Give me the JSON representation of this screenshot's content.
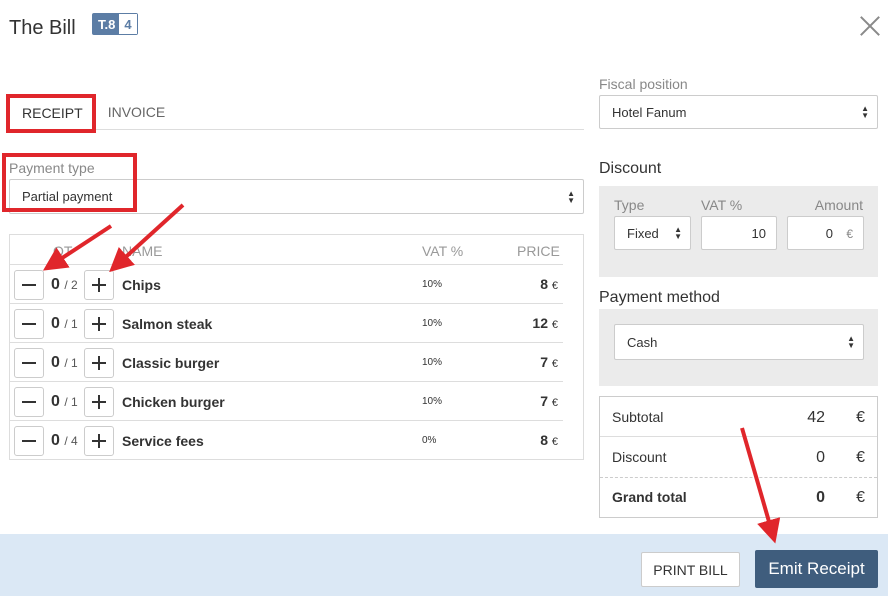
{
  "header": {
    "title": "The Bill",
    "table_code": "T.8",
    "guest_count": "4",
    "close_icon": "close-icon"
  },
  "tabs": [
    {
      "label": "RECEIPT",
      "active": true
    },
    {
      "label": "INVOICE",
      "active": false
    }
  ],
  "payment_type": {
    "label": "Payment type",
    "value": "Partial payment"
  },
  "table": {
    "headers": {
      "qty": "QT",
      "name": "NAME",
      "vat": "VAT %",
      "price": "PRICE"
    },
    "rows": [
      {
        "qty": "0",
        "max": "/ 2",
        "name": "Chips",
        "vat": "10%",
        "price": "8",
        "currency": "€"
      },
      {
        "qty": "0",
        "max": "/ 1",
        "name": "Salmon steak",
        "vat": "10%",
        "price": "12",
        "currency": "€"
      },
      {
        "qty": "0",
        "max": "/ 1",
        "name": "Classic burger",
        "vat": "10%",
        "price": "7",
        "currency": "€"
      },
      {
        "qty": "0",
        "max": "/ 1",
        "name": "Chicken burger",
        "vat": "10%",
        "price": "7",
        "currency": "€"
      },
      {
        "qty": "0",
        "max": "/ 4",
        "name": "Service fees",
        "vat": "0%",
        "price": "8",
        "currency": "€"
      }
    ]
  },
  "fiscal_position": {
    "label": "Fiscal position",
    "value": "Hotel Fanum"
  },
  "discount": {
    "title": "Discount",
    "type_label": "Type",
    "type_value": "Fixed",
    "vat_label": "VAT %",
    "vat_value": "10",
    "amount_label": "Amount",
    "amount_value": "0",
    "amount_currency": "€"
  },
  "payment_method": {
    "title": "Payment method",
    "value": "Cash"
  },
  "totals": {
    "subtotal_label": "Subtotal",
    "subtotal_value": "42",
    "discount_label": "Discount",
    "discount_value": "0",
    "grand_total_label": "Grand total",
    "grand_total_value": "0",
    "currency": "€"
  },
  "footer": {
    "print_label": "PRINT BILL",
    "emit_label": "Emit Receipt"
  },
  "colors": {
    "accent": "#3f5d7d",
    "badge": "#5c7da5",
    "annotation": "#e0262b",
    "footer_bg": "#dbe8f5"
  }
}
